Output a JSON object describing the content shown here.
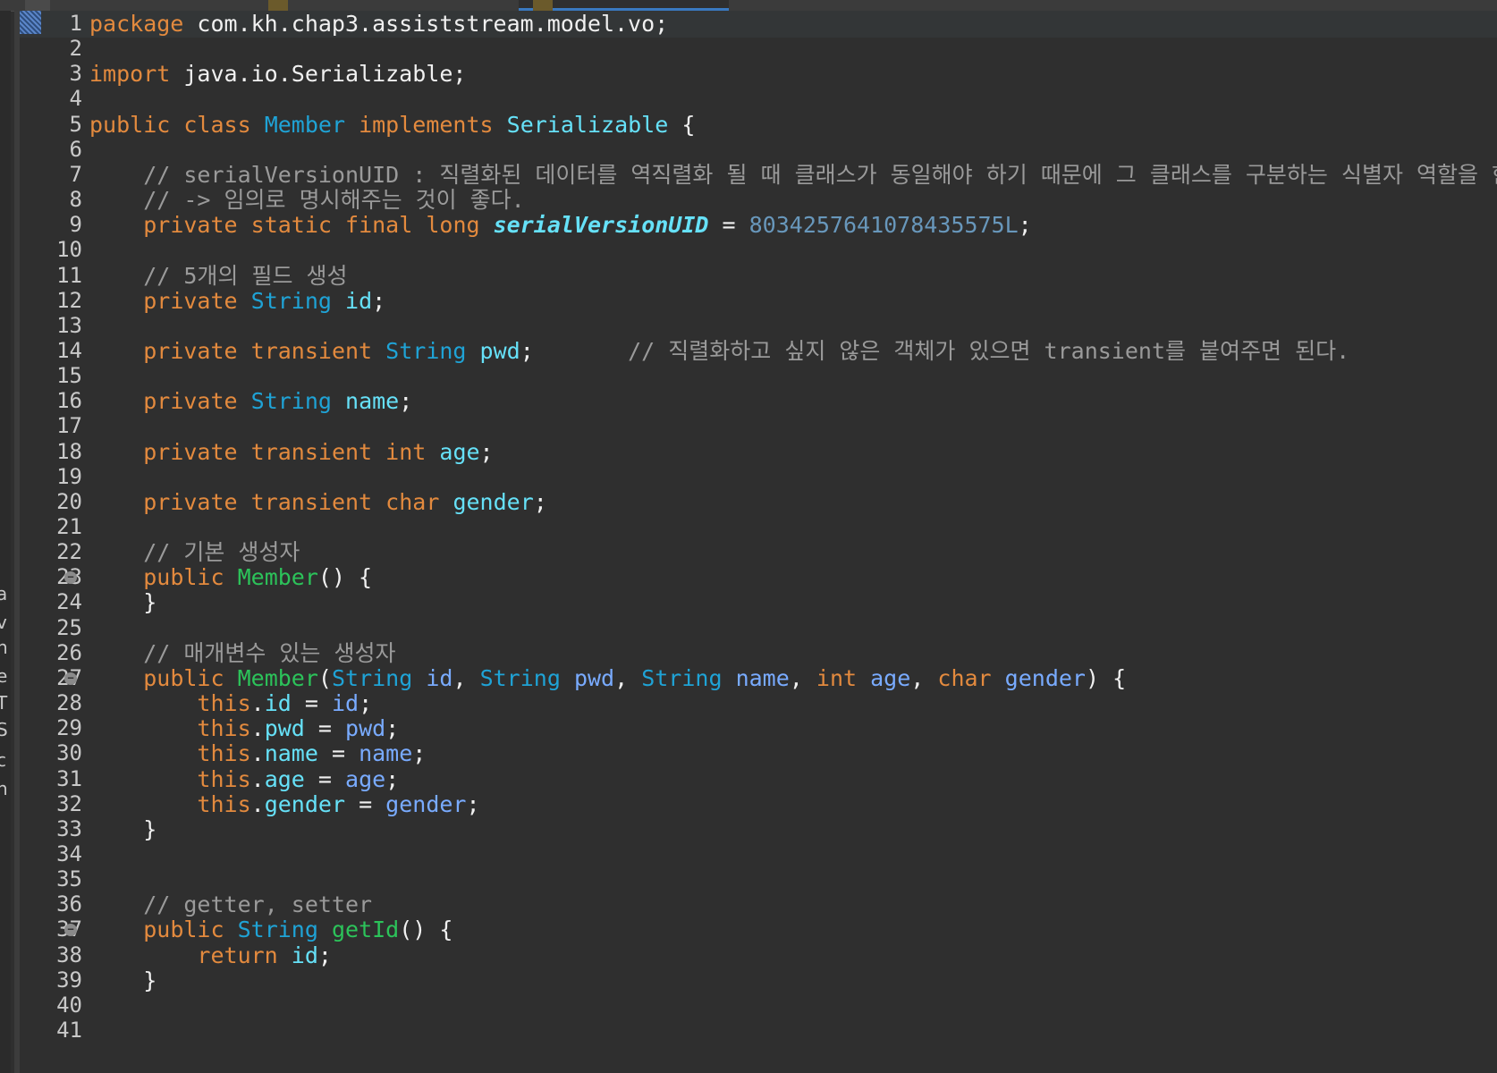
{
  "editor": {
    "lines": [
      {
        "no": "1",
        "tokens": [
          {
            "t": "package",
            "c": "kw"
          },
          {
            "t": " com.kh.chap3.assiststream.model.vo;",
            "c": "plain"
          }
        ]
      },
      {
        "no": "2",
        "tokens": []
      },
      {
        "no": "3",
        "tokens": [
          {
            "t": "import",
            "c": "kw"
          },
          {
            "t": " java.io.Serializable;",
            "c": "plain"
          }
        ]
      },
      {
        "no": "4",
        "tokens": []
      },
      {
        "no": "5",
        "tokens": [
          {
            "t": "public",
            "c": "kw"
          },
          {
            "t": " ",
            "c": "plain"
          },
          {
            "t": "class",
            "c": "kw"
          },
          {
            "t": " ",
            "c": "plain"
          },
          {
            "t": "Member",
            "c": "ty"
          },
          {
            "t": " ",
            "c": "plain"
          },
          {
            "t": "implements",
            "c": "kw"
          },
          {
            "t": " ",
            "c": "plain"
          },
          {
            "t": "Serializable",
            "c": "fld"
          },
          {
            "t": " {",
            "c": "plain"
          }
        ]
      },
      {
        "no": "6",
        "tokens": []
      },
      {
        "no": "7",
        "tokens": [
          {
            "t": "    // serialVersionUID : 직렬화된 데이터를 역직렬화 될 때 클래스가 동일해야 하기 때문에 그 클래스를 구분하는 식별자 역할을 한다.",
            "c": "cm"
          }
        ]
      },
      {
        "no": "8",
        "tokens": [
          {
            "t": "    // -> 임의로 명시해주는 것이 좋다.",
            "c": "cm"
          }
        ]
      },
      {
        "no": "9",
        "tokens": [
          {
            "t": "    ",
            "c": "plain"
          },
          {
            "t": "private",
            "c": "kw"
          },
          {
            "t": " ",
            "c": "plain"
          },
          {
            "t": "static",
            "c": "kw"
          },
          {
            "t": " ",
            "c": "plain"
          },
          {
            "t": "final",
            "c": "kw"
          },
          {
            "t": " ",
            "c": "plain"
          },
          {
            "t": "long",
            "c": "kw"
          },
          {
            "t": " ",
            "c": "plain"
          },
          {
            "t": "serialVersionUID",
            "c": "static-fld"
          },
          {
            "t": " = ",
            "c": "plain"
          },
          {
            "t": "8034257641078435575L",
            "c": "num"
          },
          {
            "t": ";",
            "c": "plain"
          }
        ]
      },
      {
        "no": "10",
        "tokens": []
      },
      {
        "no": "11",
        "tokens": [
          {
            "t": "    // 5개의 필드 생성",
            "c": "cm"
          }
        ]
      },
      {
        "no": "12",
        "tokens": [
          {
            "t": "    ",
            "c": "plain"
          },
          {
            "t": "private",
            "c": "kw"
          },
          {
            "t": " ",
            "c": "plain"
          },
          {
            "t": "String",
            "c": "ty"
          },
          {
            "t": " ",
            "c": "plain"
          },
          {
            "t": "id",
            "c": "fld"
          },
          {
            "t": ";",
            "c": "plain"
          }
        ]
      },
      {
        "no": "13",
        "tokens": []
      },
      {
        "no": "14",
        "tokens": [
          {
            "t": "    ",
            "c": "plain"
          },
          {
            "t": "private",
            "c": "kw"
          },
          {
            "t": " ",
            "c": "plain"
          },
          {
            "t": "transient",
            "c": "kw"
          },
          {
            "t": " ",
            "c": "plain"
          },
          {
            "t": "String",
            "c": "ty"
          },
          {
            "t": " ",
            "c": "plain"
          },
          {
            "t": "pwd",
            "c": "fld"
          },
          {
            "t": ";       ",
            "c": "plain"
          },
          {
            "t": "// 직렬화하고 싶지 않은 객체가 있으면 transient를 붙여주면 된다.",
            "c": "cm"
          }
        ]
      },
      {
        "no": "15",
        "tokens": []
      },
      {
        "no": "16",
        "tokens": [
          {
            "t": "    ",
            "c": "plain"
          },
          {
            "t": "private",
            "c": "kw"
          },
          {
            "t": " ",
            "c": "plain"
          },
          {
            "t": "String",
            "c": "ty"
          },
          {
            "t": " ",
            "c": "plain"
          },
          {
            "t": "name",
            "c": "fld"
          },
          {
            "t": ";",
            "c": "plain"
          }
        ]
      },
      {
        "no": "17",
        "tokens": []
      },
      {
        "no": "18",
        "tokens": [
          {
            "t": "    ",
            "c": "plain"
          },
          {
            "t": "private",
            "c": "kw"
          },
          {
            "t": " ",
            "c": "plain"
          },
          {
            "t": "transient",
            "c": "kw"
          },
          {
            "t": " ",
            "c": "plain"
          },
          {
            "t": "int",
            "c": "kw"
          },
          {
            "t": " ",
            "c": "plain"
          },
          {
            "t": "age",
            "c": "fld"
          },
          {
            "t": ";",
            "c": "plain"
          }
        ]
      },
      {
        "no": "19",
        "tokens": []
      },
      {
        "no": "20",
        "tokens": [
          {
            "t": "    ",
            "c": "plain"
          },
          {
            "t": "private",
            "c": "kw"
          },
          {
            "t": " ",
            "c": "plain"
          },
          {
            "t": "transient",
            "c": "kw"
          },
          {
            "t": " ",
            "c": "plain"
          },
          {
            "t": "char",
            "c": "kw"
          },
          {
            "t": " ",
            "c": "plain"
          },
          {
            "t": "gender",
            "c": "fld"
          },
          {
            "t": ";",
            "c": "plain"
          }
        ]
      },
      {
        "no": "21",
        "tokens": []
      },
      {
        "no": "22",
        "tokens": [
          {
            "t": "    // 기본 생성자",
            "c": "cm"
          }
        ]
      },
      {
        "no": "23",
        "fold": true,
        "tokens": [
          {
            "t": "    ",
            "c": "plain"
          },
          {
            "t": "public",
            "c": "kw"
          },
          {
            "t": " ",
            "c": "plain"
          },
          {
            "t": "Member",
            "c": "meth"
          },
          {
            "t": "() {",
            "c": "plain"
          }
        ]
      },
      {
        "no": "24",
        "tokens": [
          {
            "t": "    }",
            "c": "plain"
          }
        ]
      },
      {
        "no": "25",
        "tokens": []
      },
      {
        "no": "26",
        "tokens": [
          {
            "t": "    // 매개변수 있는 생성자",
            "c": "cm"
          }
        ]
      },
      {
        "no": "27",
        "fold": true,
        "tokens": [
          {
            "t": "    ",
            "c": "plain"
          },
          {
            "t": "public",
            "c": "kw"
          },
          {
            "t": " ",
            "c": "plain"
          },
          {
            "t": "Member",
            "c": "meth"
          },
          {
            "t": "(",
            "c": "plain"
          },
          {
            "t": "String",
            "c": "ty"
          },
          {
            "t": " ",
            "c": "plain"
          },
          {
            "t": "id",
            "c": "param"
          },
          {
            "t": ", ",
            "c": "plain"
          },
          {
            "t": "String",
            "c": "ty"
          },
          {
            "t": " ",
            "c": "plain"
          },
          {
            "t": "pwd",
            "c": "param"
          },
          {
            "t": ", ",
            "c": "plain"
          },
          {
            "t": "String",
            "c": "ty"
          },
          {
            "t": " ",
            "c": "plain"
          },
          {
            "t": "name",
            "c": "param"
          },
          {
            "t": ", ",
            "c": "plain"
          },
          {
            "t": "int",
            "c": "kw"
          },
          {
            "t": " ",
            "c": "plain"
          },
          {
            "t": "age",
            "c": "param"
          },
          {
            "t": ", ",
            "c": "plain"
          },
          {
            "t": "char",
            "c": "kw"
          },
          {
            "t": " ",
            "c": "plain"
          },
          {
            "t": "gender",
            "c": "param"
          },
          {
            "t": ") {",
            "c": "plain"
          }
        ]
      },
      {
        "no": "28",
        "tokens": [
          {
            "t": "        ",
            "c": "plain"
          },
          {
            "t": "this",
            "c": "kw"
          },
          {
            "t": ".",
            "c": "plain"
          },
          {
            "t": "id",
            "c": "fld"
          },
          {
            "t": " = ",
            "c": "plain"
          },
          {
            "t": "id",
            "c": "param"
          },
          {
            "t": ";",
            "c": "plain"
          }
        ]
      },
      {
        "no": "29",
        "tokens": [
          {
            "t": "        ",
            "c": "plain"
          },
          {
            "t": "this",
            "c": "kw"
          },
          {
            "t": ".",
            "c": "plain"
          },
          {
            "t": "pwd",
            "c": "fld"
          },
          {
            "t": " = ",
            "c": "plain"
          },
          {
            "t": "pwd",
            "c": "param"
          },
          {
            "t": ";",
            "c": "plain"
          }
        ]
      },
      {
        "no": "30",
        "tokens": [
          {
            "t": "        ",
            "c": "plain"
          },
          {
            "t": "this",
            "c": "kw"
          },
          {
            "t": ".",
            "c": "plain"
          },
          {
            "t": "name",
            "c": "fld"
          },
          {
            "t": " = ",
            "c": "plain"
          },
          {
            "t": "name",
            "c": "param"
          },
          {
            "t": ";",
            "c": "plain"
          }
        ]
      },
      {
        "no": "31",
        "tokens": [
          {
            "t": "        ",
            "c": "plain"
          },
          {
            "t": "this",
            "c": "kw"
          },
          {
            "t": ".",
            "c": "plain"
          },
          {
            "t": "age",
            "c": "fld"
          },
          {
            "t": " = ",
            "c": "plain"
          },
          {
            "t": "age",
            "c": "param"
          },
          {
            "t": ";",
            "c": "plain"
          }
        ]
      },
      {
        "no": "32",
        "tokens": [
          {
            "t": "        ",
            "c": "plain"
          },
          {
            "t": "this",
            "c": "kw"
          },
          {
            "t": ".",
            "c": "plain"
          },
          {
            "t": "gender",
            "c": "fld"
          },
          {
            "t": " = ",
            "c": "plain"
          },
          {
            "t": "gender",
            "c": "param"
          },
          {
            "t": ";",
            "c": "plain"
          }
        ]
      },
      {
        "no": "33",
        "tokens": [
          {
            "t": "    }",
            "c": "plain"
          }
        ]
      },
      {
        "no": "34",
        "tokens": []
      },
      {
        "no": "35",
        "tokens": []
      },
      {
        "no": "36",
        "tokens": [
          {
            "t": "    // getter, setter",
            "c": "cm"
          }
        ]
      },
      {
        "no": "37",
        "fold": true,
        "tokens": [
          {
            "t": "    ",
            "c": "plain"
          },
          {
            "t": "public",
            "c": "kw"
          },
          {
            "t": " ",
            "c": "plain"
          },
          {
            "t": "String",
            "c": "ty"
          },
          {
            "t": " ",
            "c": "plain"
          },
          {
            "t": "getId",
            "c": "meth"
          },
          {
            "t": "() {",
            "c": "plain"
          }
        ]
      },
      {
        "no": "38",
        "tokens": [
          {
            "t": "        ",
            "c": "plain"
          },
          {
            "t": "return",
            "c": "kw"
          },
          {
            "t": " ",
            "c": "plain"
          },
          {
            "t": "id",
            "c": "fld"
          },
          {
            "t": ";",
            "c": "plain"
          }
        ]
      },
      {
        "no": "39",
        "tokens": [
          {
            "t": "    }",
            "c": "plain"
          }
        ]
      },
      {
        "no": "40",
        "tokens": []
      },
      {
        "no": "41",
        "tokens": []
      }
    ]
  },
  "left_stub_chars": [
    "a",
    "v",
    "n",
    "e",
    "T",
    "S",
    "c",
    "n"
  ],
  "colors": {
    "background": "#2f2f2f",
    "keyword": "#e38a3e",
    "type": "#1fa3d6",
    "field": "#66e1f8",
    "parameter": "#79abff",
    "comment": "#9a9a9a",
    "number": "#6897bb",
    "method": "#2cc35a"
  }
}
